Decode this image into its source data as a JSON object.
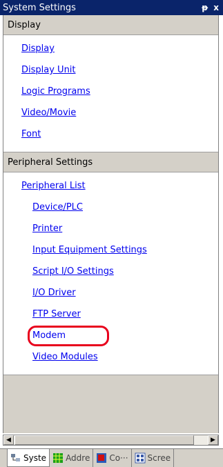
{
  "window": {
    "title": "System Settings",
    "pin_glyph": "ᵽ",
    "close_glyph": "x"
  },
  "sections": [
    {
      "header": "Display",
      "items": [
        {
          "label": "Display"
        },
        {
          "label": "Display Unit"
        },
        {
          "label": "Logic Programs"
        },
        {
          "label": "Video/Movie"
        },
        {
          "label": "Font"
        }
      ]
    },
    {
      "header": "Peripheral Settings",
      "items": [
        {
          "label": "Peripheral List"
        },
        {
          "label": "Device/PLC"
        },
        {
          "label": "Printer"
        },
        {
          "label": "Input Equipment Settings"
        },
        {
          "label": "Script I/O Settings"
        },
        {
          "label": "I/O Driver"
        },
        {
          "label": "FTP Server"
        },
        {
          "label": "Modem"
        },
        {
          "label": "Video Modules"
        }
      ]
    }
  ],
  "tabs": [
    {
      "label": "Syste",
      "icon": "tree-icon",
      "color": "#6b7f9a"
    },
    {
      "label": "Addre",
      "icon": "grid-icon",
      "color": "#1aa01a"
    },
    {
      "label": "Co···",
      "icon": "component-icon",
      "color": "#d01010"
    },
    {
      "label": "Scree",
      "icon": "screen-list-icon",
      "color": "#3a5aa8"
    }
  ],
  "scroll": {
    "left_glyph": "◀",
    "right_glyph": "▶"
  },
  "colors": {
    "titlebar": "#0a246a",
    "link": "#0000ee",
    "highlight": "#e8001c"
  }
}
